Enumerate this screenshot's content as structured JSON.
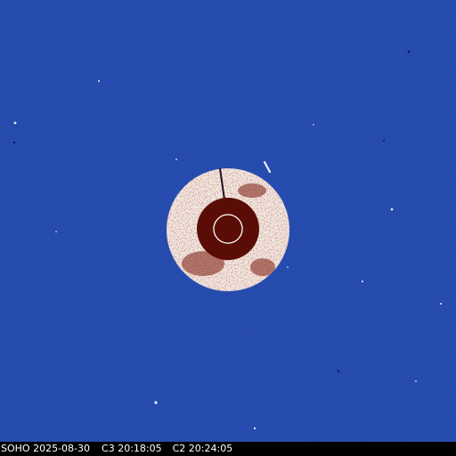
{
  "image": {
    "observatory": "SOHO",
    "date": "2025-08-30",
    "c3_label": "C3",
    "c3_time": "20:18:05",
    "c2_label": "C2",
    "c2_time": "20:24:05"
  },
  "colors": {
    "background_blue": "#1f3fa8",
    "outer_ring": "#f4ece6",
    "occulter": "#5a0d06",
    "sun_circle": "#ffffff",
    "caption_bg": "#000000",
    "caption_text": "#ffffff"
  }
}
